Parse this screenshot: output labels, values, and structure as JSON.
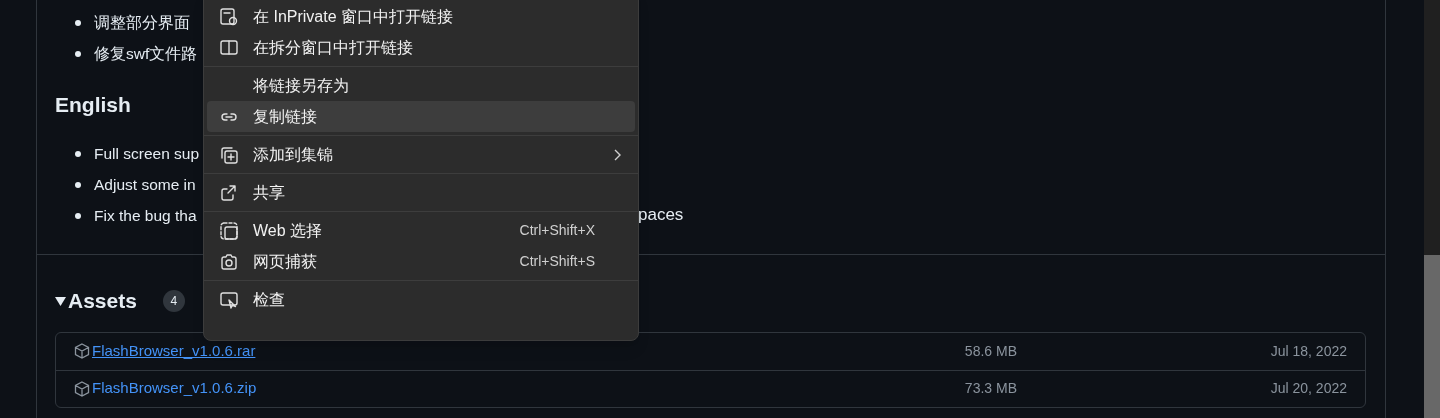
{
  "release_notes": {
    "chinese_bullets": [
      "调整部分界面",
      "修复swf文件路"
    ],
    "english_heading": "English",
    "english_bullets": [
      "Full screen sup",
      "Adjust some in",
      "Fix the bug tha"
    ],
    "english_bullet_tail": "paces"
  },
  "assets": {
    "title": "Assets",
    "count": "4",
    "expanded": true,
    "files": [
      {
        "name": "FlashBrowser_v1.0.6.rar",
        "size": "58.6 MB",
        "date": "Jul 18, 2022",
        "hovered": true
      },
      {
        "name": "FlashBrowser_v1.0.6.zip",
        "size": "73.3 MB",
        "date": "Jul 20, 2022",
        "hovered": false
      }
    ]
  },
  "context_menu": {
    "items": [
      {
        "kind": "item",
        "label": "在 InPrivate 窗口中打开链接",
        "selected": false
      },
      {
        "kind": "item",
        "label": "在拆分窗口中打开链接",
        "selected": false
      },
      {
        "kind": "divider"
      },
      {
        "kind": "item",
        "label": "将链接另存为",
        "selected": false
      },
      {
        "kind": "item",
        "label": "复制链接",
        "selected": true
      },
      {
        "kind": "divider"
      },
      {
        "kind": "item",
        "label": "添加到集锦",
        "selected": false,
        "submenu": true
      },
      {
        "kind": "divider"
      },
      {
        "kind": "item",
        "label": "共享",
        "selected": false
      },
      {
        "kind": "divider"
      },
      {
        "kind": "item",
        "label": "Web 选择",
        "selected": false,
        "shortcut": "Ctrl+Shift+X"
      },
      {
        "kind": "item",
        "label": "网页捕获",
        "selected": false,
        "shortcut": "Ctrl+Shift+S"
      },
      {
        "kind": "divider"
      },
      {
        "kind": "item",
        "label": "检查",
        "selected": false
      }
    ]
  }
}
